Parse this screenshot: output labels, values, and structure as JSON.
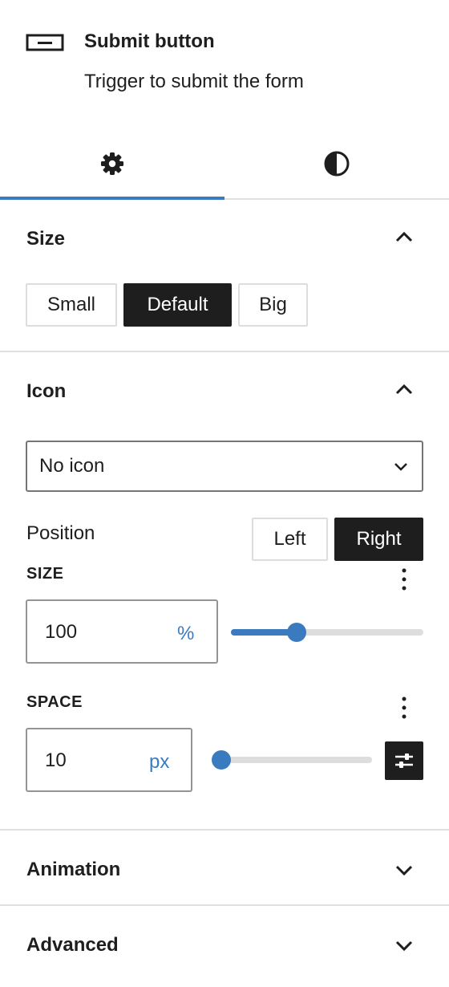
{
  "block": {
    "title": "Submit button",
    "description": "Trigger to submit the form",
    "icon": "button-block-icon"
  },
  "tabs": [
    {
      "name": "settings",
      "icon": "gear-icon",
      "active": true
    },
    {
      "name": "styles",
      "icon": "contrast-icon",
      "active": false
    }
  ],
  "size_panel": {
    "title": "Size",
    "expanded": true,
    "options": [
      "Small",
      "Default",
      "Big"
    ],
    "selected": "Default"
  },
  "icon_panel": {
    "title": "Icon",
    "expanded": true,
    "select_value": "No icon",
    "position_label": "Position",
    "position_options": [
      "Left",
      "Right"
    ],
    "position_selected": "Right",
    "size_label": "SIZE",
    "size_value": "100",
    "size_unit": "%",
    "size_slider_fraction": 0.34,
    "space_label": "SPACE",
    "space_value": "10",
    "space_unit": "px",
    "space_slider_fraction": 0.0
  },
  "animation_panel": {
    "title": "Animation",
    "expanded": false
  },
  "advanced_panel": {
    "title": "Advanced",
    "expanded": false
  },
  "colors": {
    "accent": "#3a7bbf",
    "dark": "#1e1e1e",
    "border": "#e0e0e0"
  }
}
